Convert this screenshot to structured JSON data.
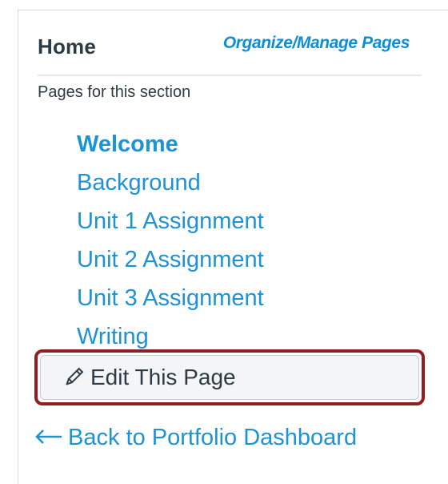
{
  "header": {
    "title": "Home",
    "manage_link": "Organize/Manage Pages"
  },
  "section": {
    "label": "Pages for this section"
  },
  "pages": [
    {
      "label": "Welcome",
      "current": true
    },
    {
      "label": "Background",
      "current": false
    },
    {
      "label": "Unit 1 Assignment",
      "current": false
    },
    {
      "label": "Unit 2 Assignment",
      "current": false
    },
    {
      "label": "Unit 3 Assignment",
      "current": false
    },
    {
      "label": "Writing",
      "current": false
    }
  ],
  "edit_button": {
    "label": "Edit This Page",
    "icon": "pencil-icon"
  },
  "back_link": {
    "label": "Back to Portfolio Dashboard",
    "icon": "arrow-left-icon"
  },
  "colors": {
    "link": "#1c93d5",
    "text": "#2d3b45",
    "highlight": "#8f1e22"
  }
}
